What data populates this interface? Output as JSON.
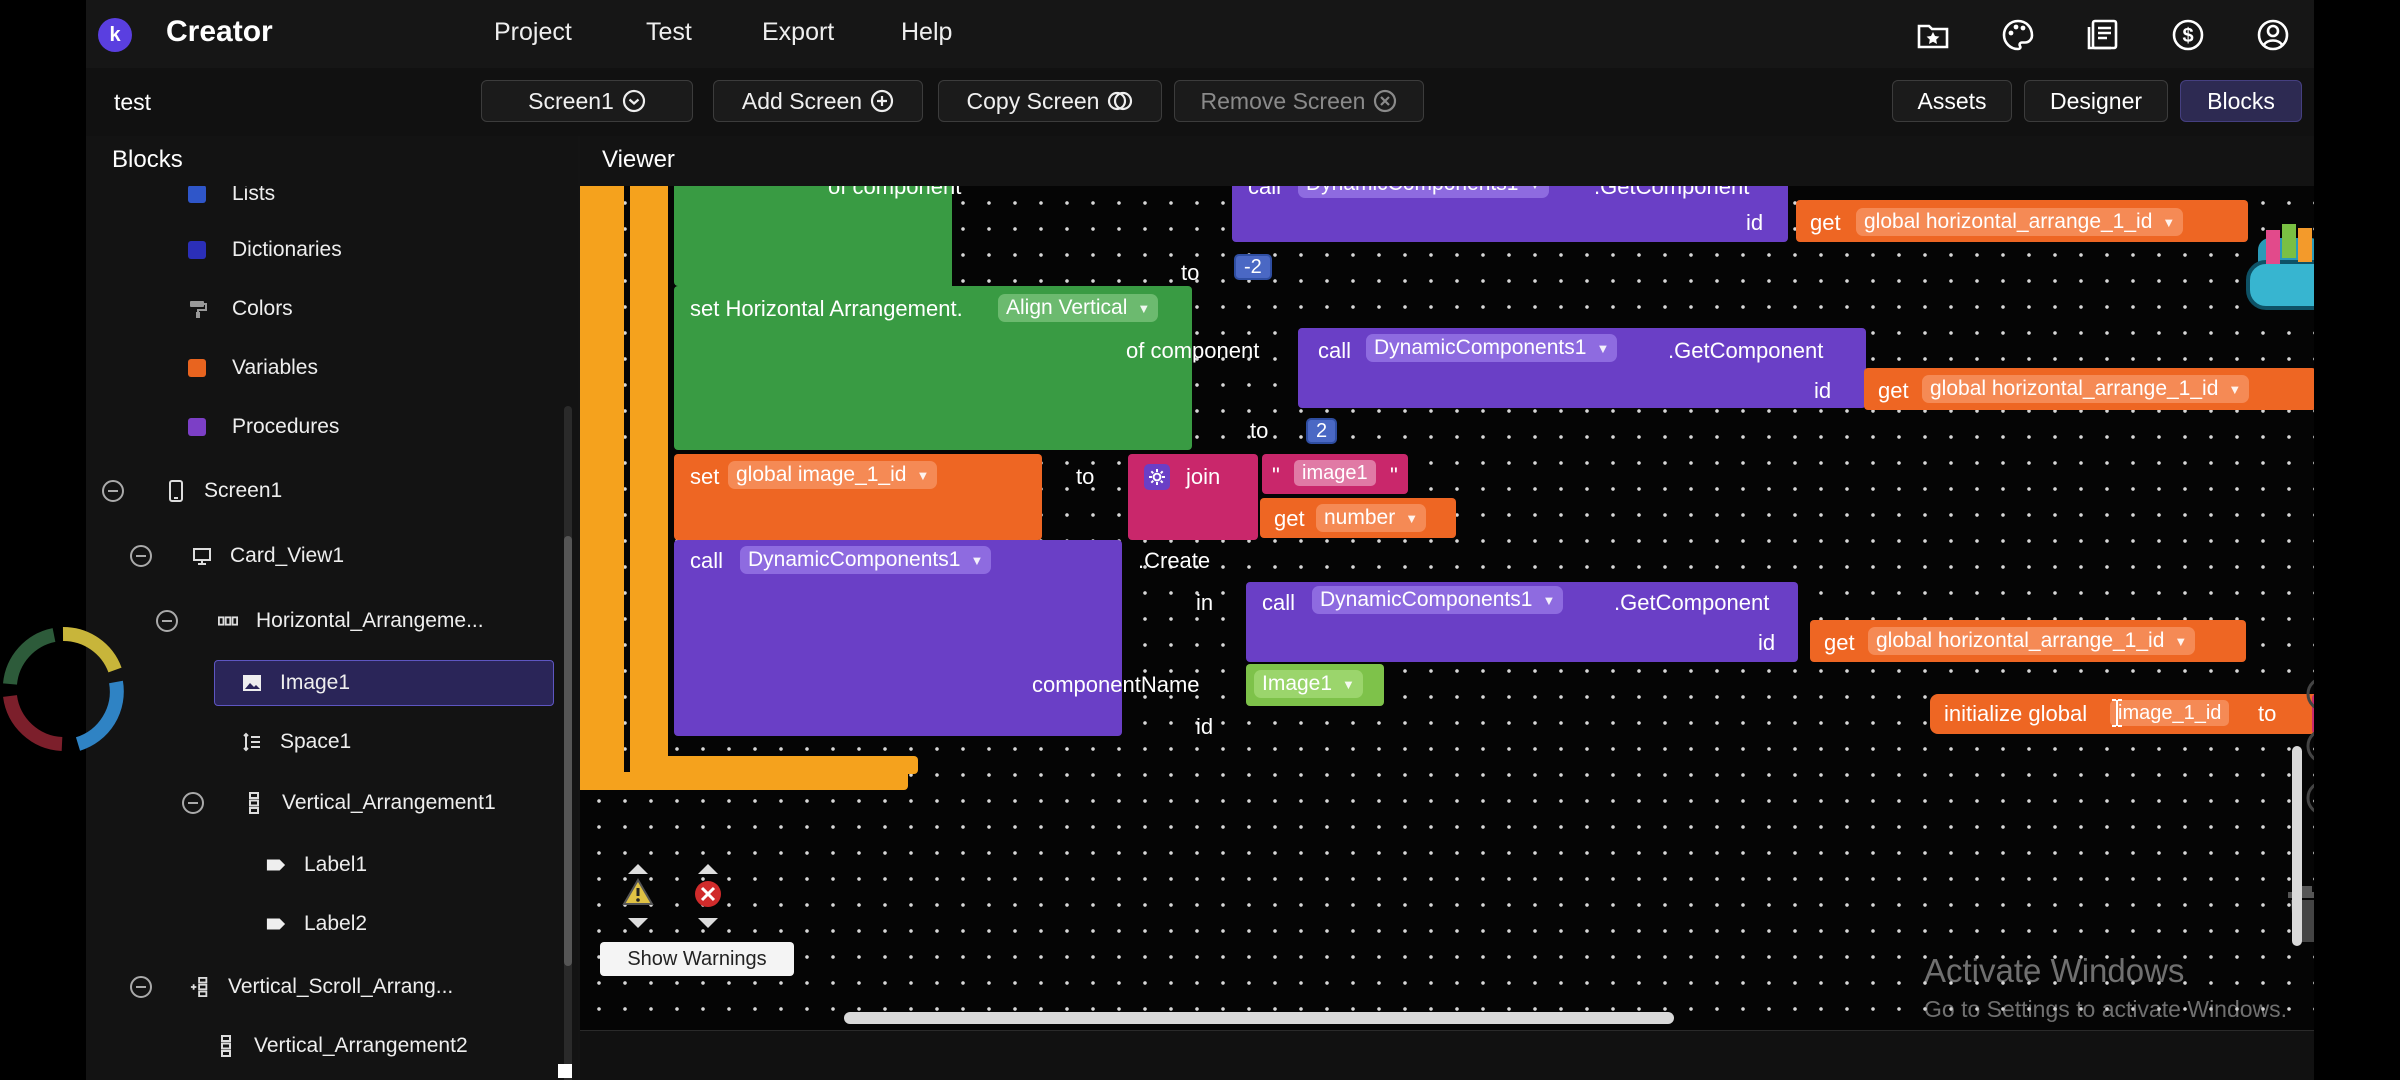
{
  "app": {
    "title": "Creator",
    "menu": [
      "Project",
      "Test",
      "Export",
      "Help"
    ],
    "top_icons": [
      "folder-star-icon",
      "palette-icon",
      "news-icon",
      "dollar-icon",
      "account-icon"
    ]
  },
  "screenbar": {
    "project_name": "test",
    "screen_select": "Screen1",
    "add_screen": "Add Screen",
    "copy_screen": "Copy Screen",
    "remove_screen": "Remove Screen",
    "assets": "Assets",
    "designer": "Designer",
    "blocks": "Blocks"
  },
  "blocks_panel": {
    "title": "Blocks",
    "builtin": [
      {
        "label": "Lists",
        "color": "#2f56c9"
      },
      {
        "label": "Dictionaries",
        "color": "#2b2fb8"
      },
      {
        "label": "Colors",
        "color": "#777777"
      },
      {
        "label": "Variables",
        "color": "#e8641f"
      },
      {
        "label": "Procedures",
        "color": "#7c3fc6"
      }
    ],
    "components": [
      {
        "label": "Screen1",
        "icon": "phone-icon"
      },
      {
        "label": "Card_View1",
        "icon": "monitor-icon"
      },
      {
        "label": "Horizontal_Arrangeme...",
        "icon": "horizontal-arrangement-icon"
      },
      {
        "label": "Image1",
        "icon": "image-icon"
      },
      {
        "label": "Space1",
        "icon": "space-icon"
      },
      {
        "label": "Vertical_Arrangement1",
        "icon": "vertical-arrangement-icon"
      },
      {
        "label": "Label1",
        "icon": "label-icon"
      },
      {
        "label": "Label2",
        "icon": "label-icon"
      },
      {
        "label": "Vertical_Scroll_Arrang...",
        "icon": "vertical-scroll-arrangement-icon"
      },
      {
        "label": "Vertical_Arrangement2",
        "icon": "vertical-arrangement-icon"
      }
    ]
  },
  "viewer": {
    "title": "Viewer",
    "blocks": {
      "of_component": "of component",
      "call": "call",
      "dyn_comp_partial": "DynamicComponents1",
      "get_component": ".GetComponent",
      "id": "id",
      "get": "get",
      "global_ha_id": "global horizontal_arrange_1_id",
      "to": "to",
      "neg_two": "-2",
      "set_ha": "set Horizontal Arrangement.",
      "align_vertical": "Align Vertical",
      "two": "2",
      "set": "set",
      "global_image_id": "global image_1_id",
      "join": "join",
      "quote_left": "\"",
      "image1_str": "image1",
      "quote_right": "\"",
      "number": "number",
      "dyn_comp": "DynamicComponents1",
      "create": ".Create",
      "in": "in",
      "component_name": "componentName",
      "image1_comp": "Image1",
      "initialize_global": "initialize global",
      "image_1_id": "image_1_id",
      "empty_str": "\""
    },
    "show_warnings": "Show Warnings",
    "watermark_title": "Activate Windows",
    "watermark_sub": "Go to Settings to activate Windows."
  }
}
